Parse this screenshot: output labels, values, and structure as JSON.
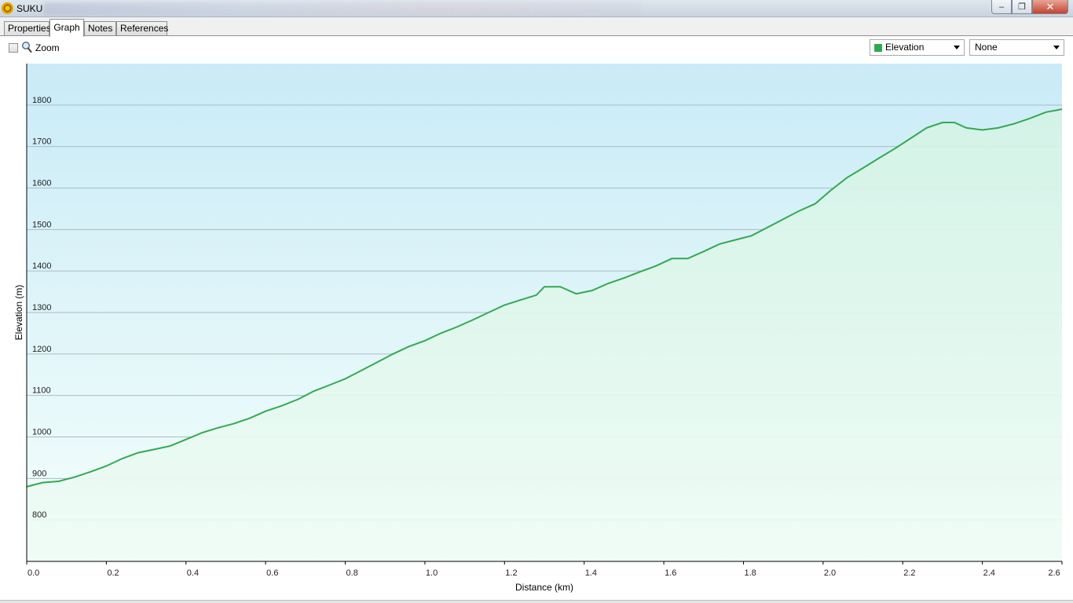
{
  "window": {
    "title": "SUKU",
    "controls": {
      "minimize": "‒",
      "maximize": "❐",
      "close": "✕"
    }
  },
  "tabs": [
    {
      "label": "Properties",
      "active": false
    },
    {
      "label": "Graph",
      "active": true
    },
    {
      "label": "Notes",
      "active": false
    },
    {
      "label": "References",
      "active": false
    }
  ],
  "toolbar": {
    "zoom_label": "Zoom",
    "zoom_checked": false,
    "series_select": {
      "value": "Elevation",
      "color": "#2eaa4f"
    },
    "secondary_select": {
      "value": "None"
    }
  },
  "colors": {
    "line": "#34a853",
    "fill_top": "#d4f3e6",
    "bg_top": "#c9ebf7",
    "bg_bottom": "#f5fffb"
  },
  "chart_data": {
    "type": "area",
    "xlabel": "Distance  (km)",
    "ylabel": "Elevation (m)",
    "xlim": [
      0,
      2.6
    ],
    "ylim": [
      700,
      1900
    ],
    "x_ticks": [
      "0.0",
      "0.2",
      "0.4",
      "0.6",
      "0.8",
      "1.0",
      "1.2",
      "1.4",
      "1.6",
      "1.8",
      "2.0",
      "2.2",
      "2.4",
      "2.6"
    ],
    "y_ticks": [
      "800",
      "900",
      "1000",
      "1100",
      "1200",
      "1300",
      "1400",
      "1500",
      "1600",
      "1700",
      "1800"
    ],
    "grid": true,
    "series": [
      {
        "x": [
          0.0,
          0.04,
          0.08,
          0.12,
          0.16,
          0.2,
          0.24,
          0.28,
          0.32,
          0.36,
          0.4,
          0.44,
          0.48,
          0.52,
          0.56,
          0.6,
          0.64,
          0.68,
          0.72,
          0.76,
          0.8,
          0.84,
          0.88,
          0.92,
          0.96,
          1.0,
          1.04,
          1.08,
          1.12,
          1.16,
          1.2,
          1.24,
          1.28,
          1.3,
          1.34,
          1.38,
          1.42,
          1.46,
          1.5,
          1.54,
          1.58,
          1.62,
          1.66,
          1.7,
          1.74,
          1.78,
          1.82,
          1.86,
          1.9,
          1.94,
          1.98,
          2.02,
          2.06,
          2.1,
          2.14,
          2.18,
          2.22,
          2.26,
          2.3,
          2.33,
          2.36,
          2.4,
          2.44,
          2.48,
          2.52,
          2.56,
          2.6
        ],
        "y": [
          880,
          890,
          893,
          903,
          916,
          930,
          948,
          962,
          970,
          978,
          994,
          1010,
          1022,
          1032,
          1045,
          1062,
          1075,
          1090,
          1110,
          1125,
          1140,
          1160,
          1180,
          1200,
          1218,
          1232,
          1250,
          1265,
          1282,
          1300,
          1318,
          1330,
          1342,
          1362,
          1362,
          1345,
          1353,
          1370,
          1383,
          1398,
          1412,
          1430,
          1430,
          1447,
          1465,
          1475,
          1485,
          1505,
          1525,
          1545,
          1562,
          1595,
          1625,
          1648,
          1672,
          1695,
          1720,
          1745,
          1758,
          1758,
          1745,
          1740,
          1745,
          1755,
          1768,
          1783,
          1790
        ]
      }
    ]
  }
}
